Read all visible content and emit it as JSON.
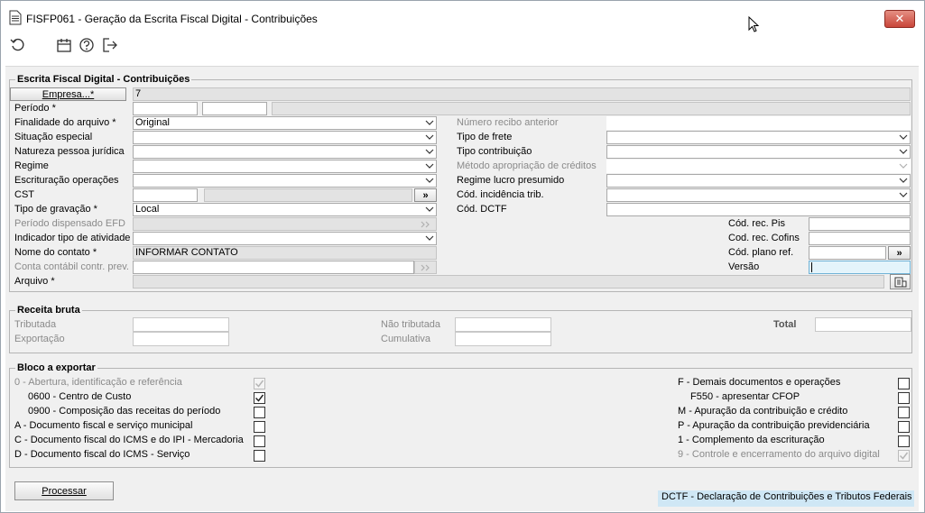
{
  "window": {
    "title": "FISFP061 - Geração da Escrita Fiscal Digital - Contribuições",
    "close_label": "✕"
  },
  "toolbar": {
    "icons": [
      "refresh-icon",
      "calendar-icon",
      "help-icon",
      "exit-icon"
    ]
  },
  "main_group": {
    "legend": "Escrita Fiscal Digital - Contribuições",
    "empresa_button": "Empresa...*",
    "empresa_value": "7",
    "periodo_label": "Período *",
    "finalidade_label": "Finalidade do arquivo *",
    "finalidade_value": "Original",
    "situacao_label": "Situação especial",
    "natureza_label": "Natureza pessoa jurídica",
    "regime_label": "Regime",
    "escrituracao_label": "Escrituração operações",
    "cst_label": "CST",
    "tipo_gravacao_label": "Tipo de gravação *",
    "tipo_gravacao_value": "Local",
    "periodo_dispensado_label": "Período dispensado EFD",
    "indicador_label": "Indicador tipo de atividade",
    "nome_contato_label": "Nome do contato *",
    "nome_contato_value": "INFORMAR CONTATO",
    "conta_contabil_label": "Conta contábil contr. prev.",
    "arquivo_label": "Arquivo *",
    "numero_recibo_label": "Número recibo anterior",
    "tipo_frete_label": "Tipo de frete",
    "tipo_contribuicao_label": "Tipo contribuição",
    "metodo_label": "Método apropriação de créditos",
    "regime_lucro_label": "Regime lucro presumido",
    "cod_incidencia_label": "Cód. incidência trib.",
    "cod_dctf_label": "Cód. DCTF",
    "cod_rec_pis_label": "Cód. rec. Pis",
    "cod_rec_cofins_label": "Cod. rec. Cofins",
    "cod_plano_label": "Cód. plano ref.",
    "versao_label": "Versão",
    "lookup_symbol": "»"
  },
  "receita_group": {
    "legend": "Receita bruta",
    "tributada_label": "Tributada",
    "exportacao_label": "Exportação",
    "nao_tributada_label": "Não tributada",
    "cumulativa_label": "Cumulativa",
    "total_label": "Total"
  },
  "bloco_group": {
    "legend": "Bloco a exportar",
    "left_items": [
      {
        "label": "0 - Abertura, identificação e referência",
        "checked": true,
        "disabled": true
      },
      {
        "label": "0600 - Centro de Custo",
        "checked": true,
        "disabled": false
      },
      {
        "label": "0900 - Composição das receitas do período",
        "checked": false,
        "disabled": false
      },
      {
        "label": "A - Documento fiscal e serviço municipal",
        "checked": false,
        "disabled": false
      },
      {
        "label": "C - Documento fiscal do ICMS e do IPI - Mercadoria",
        "checked": false,
        "disabled": false
      },
      {
        "label": "D - Documento fiscal do ICMS - Serviço",
        "checked": false,
        "disabled": false
      }
    ],
    "right_items": [
      {
        "label": "F - Demais documentos e operações",
        "checked": false,
        "disabled": false
      },
      {
        "label": "F550 - apresentar CFOP",
        "checked": false,
        "disabled": false
      },
      {
        "label": "M - Apuração da contribuição e crédito",
        "checked": false,
        "disabled": false
      },
      {
        "label": "P - Apuração da contribuição previdenciária",
        "checked": false,
        "disabled": false
      },
      {
        "label": "1 - Complemento da escrituração",
        "checked": false,
        "disabled": false
      },
      {
        "label": "9 - Controle e encerramento do arquivo digital",
        "checked": true,
        "disabled": true
      }
    ]
  },
  "footer": {
    "processar_label": "Processar",
    "status_text": "DCTF - Declaração de Contribuições e Tributos Federais"
  },
  "colors": {
    "accent": "#cfe7f5",
    "close_red": "#c9463a"
  }
}
